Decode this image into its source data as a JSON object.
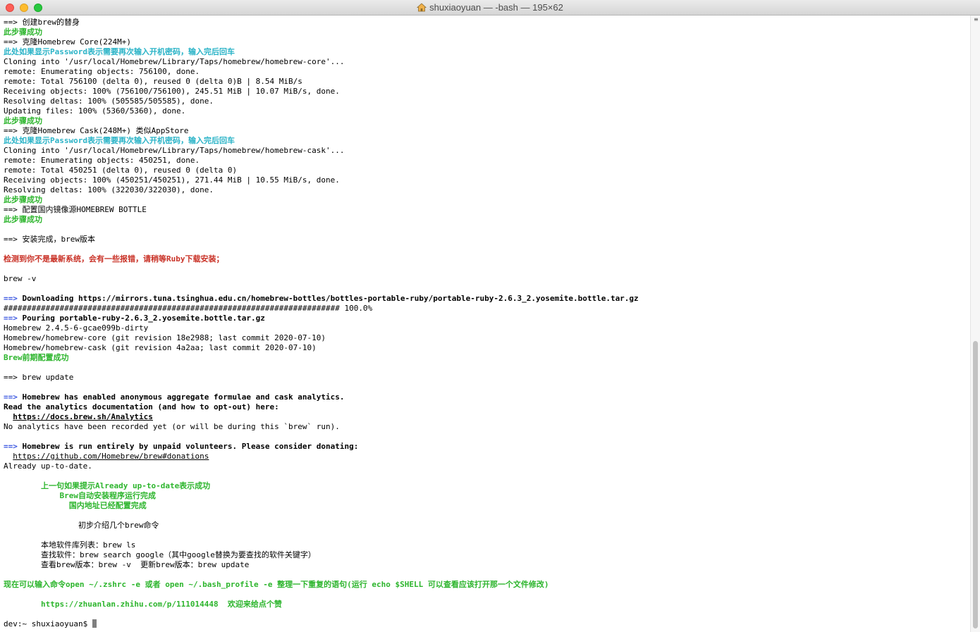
{
  "window": {
    "title": "shuxiaoyuan — -bash — 195×62"
  },
  "terminal": {
    "lines": [
      [
        {
          "t": "==> 创建brew的替身"
        }
      ],
      [
        {
          "t": "此步骤成功",
          "c": "green"
        }
      ],
      [
        {
          "t": "==> 克隆Homebrew Core(224M+)"
        }
      ],
      [
        {
          "t": "此处如果显示Password表示需要再次输入开机密码，输入完后回车",
          "c": "cyan"
        }
      ],
      [
        {
          "t": "Cloning into '/usr/local/Homebrew/Library/Taps/homebrew/homebrew-core'..."
        }
      ],
      [
        {
          "t": "remote: Enumerating objects: 756100, done."
        }
      ],
      [
        {
          "t": "remote: Total 756100 (delta 0), reused 0 (delta 0)B | 8.54 MiB/s"
        }
      ],
      [
        {
          "t": "Receiving objects: 100% (756100/756100), 245.51 MiB | 10.07 MiB/s, done."
        }
      ],
      [
        {
          "t": "Resolving deltas: 100% (505585/505585), done."
        }
      ],
      [
        {
          "t": "Updating files: 100% (5360/5360), done."
        }
      ],
      [
        {
          "t": "此步骤成功",
          "c": "green"
        }
      ],
      [
        {
          "t": "==> 克隆Homebrew Cask(248M+) 类似AppStore"
        }
      ],
      [
        {
          "t": "此处如果显示Password表示需要再次输入开机密码，输入完后回车",
          "c": "cyan"
        }
      ],
      [
        {
          "t": "Cloning into '/usr/local/Homebrew/Library/Taps/homebrew/homebrew-cask'..."
        }
      ],
      [
        {
          "t": "remote: Enumerating objects: 450251, done."
        }
      ],
      [
        {
          "t": "remote: Total 450251 (delta 0), reused 0 (delta 0)"
        }
      ],
      [
        {
          "t": "Receiving objects: 100% (450251/450251), 271.44 MiB | 10.55 MiB/s, done."
        }
      ],
      [
        {
          "t": "Resolving deltas: 100% (322030/322030), done."
        }
      ],
      [
        {
          "t": "此步骤成功",
          "c": "green"
        }
      ],
      [
        {
          "t": "==> 配置国内镜像源HOMEBREW BOTTLE"
        }
      ],
      [
        {
          "t": "此步骤成功",
          "c": "green"
        }
      ],
      [
        {
          "t": ""
        }
      ],
      [
        {
          "t": "==> 安装完成，brew版本"
        }
      ],
      [
        {
          "t": ""
        }
      ],
      [
        {
          "t": "检测到你不是最新系统，会有一些报错，请稍等Ruby下载安装；",
          "c": "red"
        }
      ],
      [
        {
          "t": ""
        }
      ],
      [
        {
          "t": "brew -v"
        }
      ],
      [
        {
          "t": ""
        }
      ],
      [
        {
          "t": "==>",
          "c": "blue"
        },
        {
          "t": " Downloading https://mirrors.tuna.tsinghua.edu.cn/homebrew-bottles/bottles-portable-ruby/portable-ruby-2.6.3_2.yosemite.bottle.tar.gz",
          "c": "bold"
        }
      ],
      [
        {
          "t": "######################################################################## 100.0%"
        }
      ],
      [
        {
          "t": "==>",
          "c": "blue"
        },
        {
          "t": " Pouring portable-ruby-2.6.3_2.yosemite.bottle.tar.gz",
          "c": "bold"
        }
      ],
      [
        {
          "t": "Homebrew 2.4.5-6-gcae099b-dirty"
        }
      ],
      [
        {
          "t": "Homebrew/homebrew-core (git revision 18e2988; last commit 2020-07-10)"
        }
      ],
      [
        {
          "t": "Homebrew/homebrew-cask (git revision 4a2aa; last commit 2020-07-10)"
        }
      ],
      [
        {
          "t": "Brew前期配置成功",
          "c": "green"
        }
      ],
      [
        {
          "t": ""
        }
      ],
      [
        {
          "t": "==> brew update"
        }
      ],
      [
        {
          "t": ""
        }
      ],
      [
        {
          "t": "==>",
          "c": "blue"
        },
        {
          "t": " Homebrew has enabled anonymous aggregate formulae and cask analytics.",
          "c": "bold"
        }
      ],
      [
        {
          "t": "Read the analytics documentation (and how to opt-out) here:",
          "c": "bold"
        }
      ],
      [
        {
          "t": "  "
        },
        {
          "t": "https://docs.brew.sh/Analytics",
          "c": "link-bold"
        }
      ],
      [
        {
          "t": "No analytics have been recorded yet (or will be during this `brew` run)."
        }
      ],
      [
        {
          "t": ""
        }
      ],
      [
        {
          "t": "==>",
          "c": "blue"
        },
        {
          "t": " Homebrew is run entirely by unpaid volunteers. Please consider donating:",
          "c": "bold"
        }
      ],
      [
        {
          "t": "  "
        },
        {
          "t": "https://github.com/Homebrew/brew#donations",
          "c": "link"
        }
      ],
      [
        {
          "t": "Already up-to-date."
        }
      ],
      [
        {
          "t": ""
        }
      ],
      [
        {
          "t": "        上一句如果提示Already up-to-date表示成功",
          "c": "green"
        }
      ],
      [
        {
          "t": "            Brew自动安装程序运行完成",
          "c": "green"
        }
      ],
      [
        {
          "t": "              国内地址已经配置完成",
          "c": "green"
        }
      ],
      [
        {
          "t": ""
        }
      ],
      [
        {
          "t": "                初步介绍几个brew命令"
        }
      ],
      [
        {
          "t": ""
        }
      ],
      [
        {
          "t": "        本地软件库列表：brew ls"
        }
      ],
      [
        {
          "t": "        查找软件：brew search google（其中google替换为要查找的软件关键字）"
        }
      ],
      [
        {
          "t": "        查看brew版本：brew -v  更新brew版本：brew update"
        }
      ],
      [
        {
          "t": ""
        }
      ],
      [
        {
          "t": "现在可以输入命令open ~/.zshrc -e 或者 open ~/.bash_profile -e 整理一下重复的语句(运行 echo $SHELL 可以查看应该打开那一个文件修改)",
          "c": "green"
        }
      ],
      [
        {
          "t": ""
        }
      ],
      [
        {
          "t": "        https://zhuanlan.zhihu.com/p/111014448  欢迎来给点个赞",
          "c": "green"
        }
      ],
      [
        {
          "t": ""
        }
      ],
      [
        {
          "t": "dev:~ shuxiaoyuan$ "
        },
        {
          "cursor": true
        }
      ]
    ]
  },
  "scrollbar": {
    "position_fraction": 1.0
  },
  "icons": {
    "title_icon": "home-folder-icon",
    "scroll_marker": "scroll-marks-icon"
  }
}
